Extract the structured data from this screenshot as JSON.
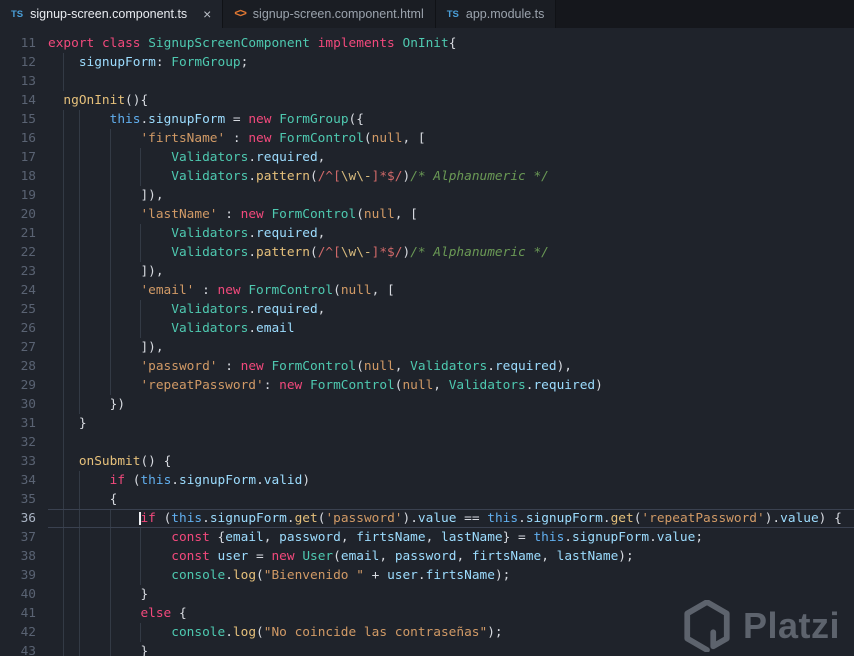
{
  "tabs": [
    {
      "label": "signup-screen.component.ts",
      "icon": "ts",
      "glyph": "TS",
      "active": true,
      "close": "×"
    },
    {
      "label": "signup-screen.component.html",
      "icon": "html",
      "glyph": "<>",
      "active": false
    },
    {
      "label": "app.module.ts",
      "icon": "ts",
      "glyph": "TS",
      "active": false
    }
  ],
  "editor": {
    "current_line": 36,
    "lines": [
      {
        "n": 11,
        "ind": 0,
        "t": [
          [
            "kw",
            "export"
          ],
          [
            "pl",
            " "
          ],
          [
            "kw",
            "class"
          ],
          [
            "pl",
            " "
          ],
          [
            "type",
            "SignupScreenComponent"
          ],
          [
            "pl",
            " "
          ],
          [
            "kw",
            "implements"
          ],
          [
            "pl",
            " "
          ],
          [
            "type",
            "OnInit"
          ],
          [
            "pl",
            "{"
          ]
        ]
      },
      {
        "n": 12,
        "ind": 4,
        "t": [
          [
            "prop",
            "signupForm"
          ],
          [
            "pl",
            ": "
          ],
          [
            "type",
            "FormGroup"
          ],
          [
            "pl",
            ";"
          ]
        ]
      },
      {
        "n": 13,
        "ind": 4,
        "t": []
      },
      {
        "n": 14,
        "ind": 2,
        "t": [
          [
            "fn",
            "ngOnInit"
          ],
          [
            "pl",
            "(){"
          ]
        ]
      },
      {
        "n": 15,
        "ind": 8,
        "t": [
          [
            "th",
            "this"
          ],
          [
            "pl",
            "."
          ],
          [
            "prop",
            "signupForm"
          ],
          [
            "pl",
            " = "
          ],
          [
            "kw",
            "new"
          ],
          [
            "pl",
            " "
          ],
          [
            "type",
            "FormGroup"
          ],
          [
            "pl",
            "({"
          ]
        ]
      },
      {
        "n": 16,
        "ind": 12,
        "t": [
          [
            "str",
            "'firtsName'"
          ],
          [
            "pl",
            " : "
          ],
          [
            "kw",
            "new"
          ],
          [
            "pl",
            " "
          ],
          [
            "type",
            "FormControl"
          ],
          [
            "pl",
            "("
          ],
          [
            "lit",
            "null"
          ],
          [
            "pl",
            ", ["
          ]
        ]
      },
      {
        "n": 17,
        "ind": 16,
        "t": [
          [
            "type",
            "Validators"
          ],
          [
            "pl",
            "."
          ],
          [
            "prop",
            "required"
          ],
          [
            "pl",
            ","
          ]
        ]
      },
      {
        "n": 18,
        "ind": 16,
        "t": [
          [
            "type",
            "Validators"
          ],
          [
            "pl",
            "."
          ],
          [
            "fn",
            "pattern"
          ],
          [
            "pl",
            "("
          ],
          [
            "re",
            "/^["
          ],
          [
            "esc",
            "\\w\\-"
          ],
          [
            "re",
            "]*$/"
          ],
          [
            "pl",
            ")"
          ],
          [
            "cm",
            "/* Alphanumeric */"
          ]
        ]
      },
      {
        "n": 19,
        "ind": 12,
        "t": [
          [
            "pl",
            "]),"
          ]
        ]
      },
      {
        "n": 20,
        "ind": 12,
        "t": [
          [
            "str",
            "'lastName'"
          ],
          [
            "pl",
            " : "
          ],
          [
            "kw",
            "new"
          ],
          [
            "pl",
            " "
          ],
          [
            "type",
            "FormControl"
          ],
          [
            "pl",
            "("
          ],
          [
            "lit",
            "null"
          ],
          [
            "pl",
            ", ["
          ]
        ]
      },
      {
        "n": 21,
        "ind": 16,
        "t": [
          [
            "type",
            "Validators"
          ],
          [
            "pl",
            "."
          ],
          [
            "prop",
            "required"
          ],
          [
            "pl",
            ","
          ]
        ]
      },
      {
        "n": 22,
        "ind": 16,
        "t": [
          [
            "type",
            "Validators"
          ],
          [
            "pl",
            "."
          ],
          [
            "fn",
            "pattern"
          ],
          [
            "pl",
            "("
          ],
          [
            "re",
            "/^["
          ],
          [
            "esc",
            "\\w\\-"
          ],
          [
            "re",
            "]*$/"
          ],
          [
            "pl",
            ")"
          ],
          [
            "cm",
            "/* Alphanumeric */"
          ]
        ]
      },
      {
        "n": 23,
        "ind": 12,
        "t": [
          [
            "pl",
            "]),"
          ]
        ]
      },
      {
        "n": 24,
        "ind": 12,
        "t": [
          [
            "str",
            "'email'"
          ],
          [
            "pl",
            " : "
          ],
          [
            "kw",
            "new"
          ],
          [
            "pl",
            " "
          ],
          [
            "type",
            "FormControl"
          ],
          [
            "pl",
            "("
          ],
          [
            "lit",
            "null"
          ],
          [
            "pl",
            ", ["
          ]
        ]
      },
      {
        "n": 25,
        "ind": 16,
        "t": [
          [
            "type",
            "Validators"
          ],
          [
            "pl",
            "."
          ],
          [
            "prop",
            "required"
          ],
          [
            "pl",
            ","
          ]
        ]
      },
      {
        "n": 26,
        "ind": 16,
        "t": [
          [
            "type",
            "Validators"
          ],
          [
            "pl",
            "."
          ],
          [
            "prop",
            "email"
          ]
        ]
      },
      {
        "n": 27,
        "ind": 12,
        "t": [
          [
            "pl",
            "]),"
          ]
        ]
      },
      {
        "n": 28,
        "ind": 12,
        "t": [
          [
            "str",
            "'password'"
          ],
          [
            "pl",
            " : "
          ],
          [
            "kw",
            "new"
          ],
          [
            "pl",
            " "
          ],
          [
            "type",
            "FormControl"
          ],
          [
            "pl",
            "("
          ],
          [
            "lit",
            "null"
          ],
          [
            "pl",
            ", "
          ],
          [
            "type",
            "Validators"
          ],
          [
            "pl",
            "."
          ],
          [
            "prop",
            "required"
          ],
          [
            "pl",
            "),"
          ]
        ]
      },
      {
        "n": 29,
        "ind": 12,
        "t": [
          [
            "str",
            "'repeatPassword'"
          ],
          [
            "pl",
            ": "
          ],
          [
            "kw",
            "new"
          ],
          [
            "pl",
            " "
          ],
          [
            "type",
            "FormControl"
          ],
          [
            "pl",
            "("
          ],
          [
            "lit",
            "null"
          ],
          [
            "pl",
            ", "
          ],
          [
            "type",
            "Validators"
          ],
          [
            "pl",
            "."
          ],
          [
            "prop",
            "required"
          ],
          [
            "pl",
            ")"
          ]
        ]
      },
      {
        "n": 30,
        "ind": 8,
        "t": [
          [
            "pl",
            "})"
          ]
        ]
      },
      {
        "n": 31,
        "ind": 4,
        "t": [
          [
            "pl",
            "}"
          ]
        ]
      },
      {
        "n": 32,
        "ind": 4,
        "t": []
      },
      {
        "n": 33,
        "ind": 4,
        "t": [
          [
            "fn",
            "onSubmit"
          ],
          [
            "pl",
            "() {"
          ]
        ]
      },
      {
        "n": 34,
        "ind": 8,
        "t": [
          [
            "kw",
            "if"
          ],
          [
            "pl",
            " ("
          ],
          [
            "th",
            "this"
          ],
          [
            "pl",
            "."
          ],
          [
            "prop",
            "signupForm"
          ],
          [
            "pl",
            "."
          ],
          [
            "prop",
            "valid"
          ],
          [
            "pl",
            ")"
          ]
        ]
      },
      {
        "n": 35,
        "ind": 8,
        "t": [
          [
            "pl",
            "{"
          ]
        ]
      },
      {
        "n": 36,
        "ind": 12,
        "t": [
          [
            "kw",
            "if"
          ],
          [
            "pl",
            " ("
          ],
          [
            "th",
            "this"
          ],
          [
            "pl",
            "."
          ],
          [
            "prop",
            "signupForm"
          ],
          [
            "pl",
            "."
          ],
          [
            "fn",
            "get"
          ],
          [
            "pl",
            "("
          ],
          [
            "str",
            "'password'"
          ],
          [
            "pl",
            ")."
          ],
          [
            "prop",
            "value"
          ],
          [
            "pl",
            " == "
          ],
          [
            "th",
            "this"
          ],
          [
            "pl",
            "."
          ],
          [
            "prop",
            "signupForm"
          ],
          [
            "pl",
            "."
          ],
          [
            "fn",
            "get"
          ],
          [
            "pl",
            "("
          ],
          [
            "str",
            "'repeatPassword'"
          ],
          [
            "pl",
            ")."
          ],
          [
            "prop",
            "value"
          ],
          [
            "pl",
            ") {"
          ]
        ]
      },
      {
        "n": 37,
        "ind": 16,
        "t": [
          [
            "kw",
            "const"
          ],
          [
            "pl",
            " {"
          ],
          [
            "prop",
            "email"
          ],
          [
            "pl",
            ", "
          ],
          [
            "prop",
            "password"
          ],
          [
            "pl",
            ", "
          ],
          [
            "prop",
            "firtsName"
          ],
          [
            "pl",
            ", "
          ],
          [
            "prop",
            "lastName"
          ],
          [
            "pl",
            "} = "
          ],
          [
            "th",
            "this"
          ],
          [
            "pl",
            "."
          ],
          [
            "prop",
            "signupForm"
          ],
          [
            "pl",
            "."
          ],
          [
            "prop",
            "value"
          ],
          [
            "pl",
            ";"
          ]
        ]
      },
      {
        "n": 38,
        "ind": 16,
        "t": [
          [
            "kw",
            "const"
          ],
          [
            "pl",
            " "
          ],
          [
            "prop",
            "user"
          ],
          [
            "pl",
            " = "
          ],
          [
            "kw",
            "new"
          ],
          [
            "pl",
            " "
          ],
          [
            "type",
            "User"
          ],
          [
            "pl",
            "("
          ],
          [
            "prop",
            "email"
          ],
          [
            "pl",
            ", "
          ],
          [
            "prop",
            "password"
          ],
          [
            "pl",
            ", "
          ],
          [
            "prop",
            "firtsName"
          ],
          [
            "pl",
            ", "
          ],
          [
            "prop",
            "lastName"
          ],
          [
            "pl",
            ");"
          ]
        ]
      },
      {
        "n": 39,
        "ind": 16,
        "t": [
          [
            "type",
            "console"
          ],
          [
            "pl",
            "."
          ],
          [
            "fn",
            "log"
          ],
          [
            "pl",
            "("
          ],
          [
            "str",
            "\"Bienvenido \""
          ],
          [
            "pl",
            " + "
          ],
          [
            "prop",
            "user"
          ],
          [
            "pl",
            "."
          ],
          [
            "prop",
            "firtsName"
          ],
          [
            "pl",
            ");"
          ]
        ]
      },
      {
        "n": 40,
        "ind": 12,
        "t": [
          [
            "pl",
            "}"
          ]
        ]
      },
      {
        "n": 41,
        "ind": 12,
        "t": [
          [
            "kw",
            "else"
          ],
          [
            "pl",
            " {"
          ]
        ]
      },
      {
        "n": 42,
        "ind": 16,
        "t": [
          [
            "type",
            "console"
          ],
          [
            "pl",
            "."
          ],
          [
            "fn",
            "log"
          ],
          [
            "pl",
            "("
          ],
          [
            "str",
            "\"No coincide las contraseñas\""
          ],
          [
            "pl",
            ");"
          ]
        ]
      },
      {
        "n": 43,
        "ind": 12,
        "t": [
          [
            "pl",
            "}"
          ]
        ]
      }
    ]
  },
  "watermark": {
    "text": "Platzi"
  },
  "colors": {
    "editor_bg": "#1f232b",
    "tabbar_bg": "#15171c",
    "tab_inactive_bg": "#1a1d23",
    "tab_active_bg": "#1f232b",
    "gutter_fg": "#5a6373",
    "gutter_active_fg": "#aab4c4",
    "keyword": "#f2497c",
    "type": "#4ec9b0",
    "function": "#e5c07b",
    "property": "#9cdcfe",
    "string": "#d19a66",
    "literal": "#d19a66",
    "regex": "#d16969",
    "escape": "#d7ba7d",
    "comment": "#6a9955",
    "this_kw": "#61afef",
    "plain": "#d7dae0",
    "guide": "#333a45",
    "current_line_border": "#3a4150",
    "cursor": "#f0f2f6",
    "ts_icon": "#4a9fd8",
    "html_icon": "#e37933",
    "watermark": "#aab2bd"
  }
}
